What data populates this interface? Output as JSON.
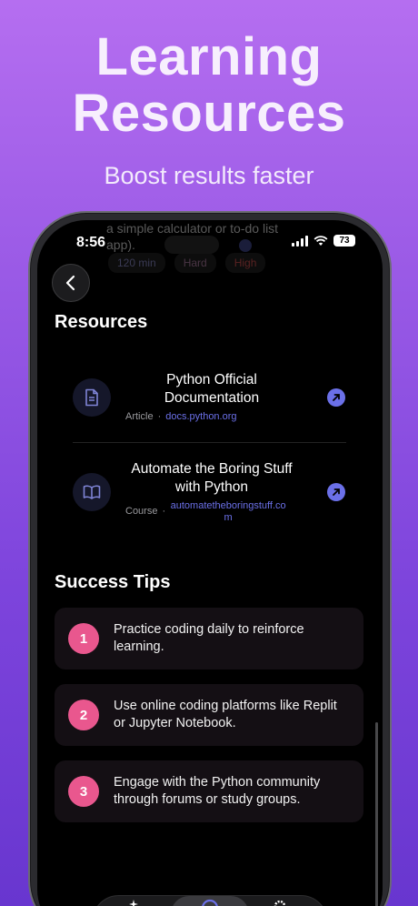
{
  "promo": {
    "title_line1": "Learning",
    "title_line2": "Resources",
    "subtitle": "Boost results faster"
  },
  "status_bar": {
    "time": "8:56",
    "battery": "73"
  },
  "background_ghost": {
    "line1": "a simple calculator or to-do list",
    "line2": "app).",
    "chips": [
      "120 min",
      "Hard",
      "High"
    ]
  },
  "resources": {
    "title": "Resources",
    "items": [
      {
        "title": "Python Official Documentation",
        "type": "Article",
        "link": "docs.python.org",
        "icon": "document-icon"
      },
      {
        "title": "Automate the Boring Stuff with Python",
        "type": "Course",
        "link": "automatetheboringstuff.com",
        "icon": "book-icon"
      }
    ]
  },
  "success_tips": {
    "title": "Success Tips",
    "items": [
      {
        "number": "1",
        "text": "Practice coding daily to reinforce learning."
      },
      {
        "number": "2",
        "text": "Use online coding platforms like Replit or Jupyter Notebook."
      },
      {
        "number": "3",
        "text": "Engage with the Python community through forums or study groups."
      }
    ]
  },
  "colors": {
    "accent": "#6b70e8",
    "tip_badge": "#e9578e",
    "background_top": "#b56ef0",
    "background_bottom": "#6836cf"
  }
}
